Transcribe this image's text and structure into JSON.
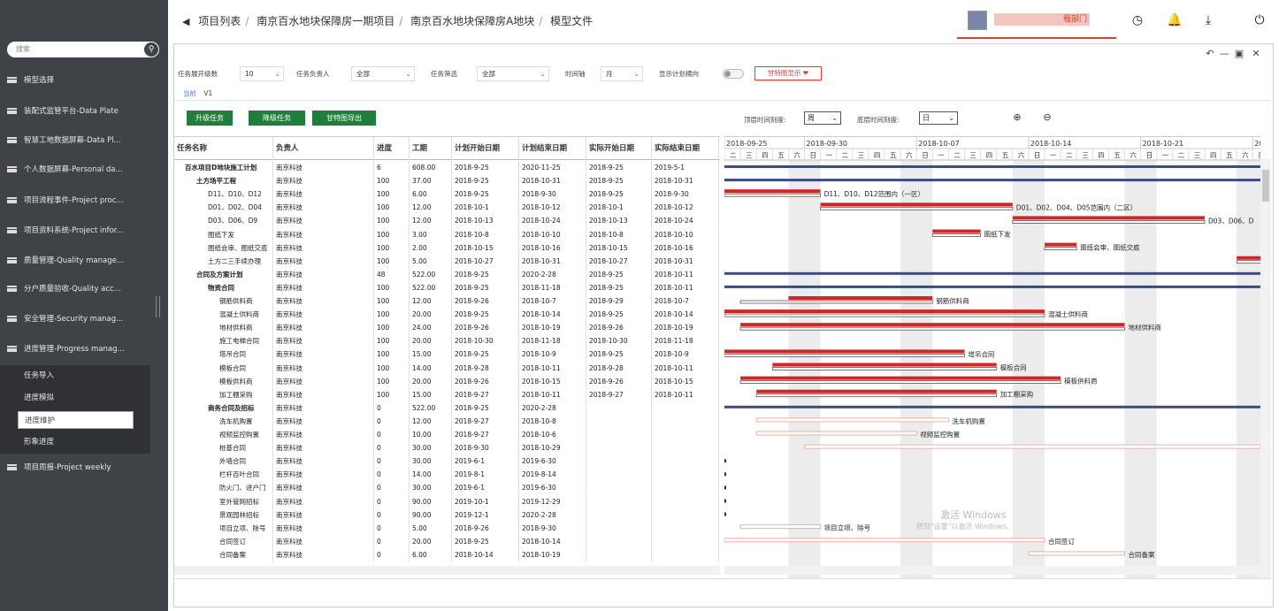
{
  "sidebar": {
    "search_placeholder": "搜索",
    "items": [
      {
        "label": "模型选择"
      },
      {
        "label": "装配式监管平台-Data Plate"
      },
      {
        "label": "智慧工地数据屏幕-Data Pl..."
      },
      {
        "label": "个人数据屏幕-Personal da..."
      },
      {
        "label": "项目流程事件-Project proc..."
      },
      {
        "label": "项目资料系统-Project infor..."
      },
      {
        "label": "质量管理-Quality manage..."
      },
      {
        "label": "分户质量验收-Quality acc..."
      },
      {
        "label": "安全管理-Security manag..."
      },
      {
        "label": "进度管理-Progress manag..."
      },
      {
        "label": "项目周报-Project weekly"
      }
    ],
    "sub_items": [
      {
        "label": "任务导入",
        "active": false
      },
      {
        "label": "进度模拟",
        "active": false
      },
      {
        "label": "进度维护",
        "active": true
      },
      {
        "label": "形象进度",
        "active": false
      }
    ]
  },
  "header": {
    "breadcrumb": [
      "项目列表",
      "南京百水地块保障房一期项目",
      "南京百水地块保障房A地块",
      "模型文件"
    ],
    "user_dept": "程部门",
    "icons": [
      "clock-icon",
      "bell-icon",
      "download-icon",
      "power-icon"
    ]
  },
  "filters": {
    "level_label": "任务展开级数",
    "level_value": "10",
    "owner_label": "任务负责人",
    "owner_value": "全部",
    "filter_label": "任务筛选",
    "filter_value": "全部",
    "axis_label": "时间轴",
    "axis_value": "月",
    "plan_toggle_label": "显示计划横向",
    "red_button": "甘特图显示 ❤"
  },
  "version": {
    "current": "当前",
    "label": "V1"
  },
  "actions": {
    "upgrade": "升级任务",
    "downgrade": "降级任务",
    "export": "甘特图导出"
  },
  "zoom": {
    "top_label": "顶层时间刻度:",
    "top_value": "周",
    "bottom_label": "底层时间刻度:",
    "bottom_value": "日"
  },
  "table": {
    "columns": [
      "任务名称",
      "负责人",
      "进度",
      "工期",
      "计划开始日期",
      "计划结束日期",
      "实际开始日期",
      "实际结束日期"
    ],
    "rows": [
      {
        "name": "百水项目D地块施工计划",
        "owner": "南京科技",
        "progress": "6",
        "duration": "608.00",
        "ps": "2018-9-25",
        "pe": "2020-11-25",
        "as": "2018-9-25",
        "ae": "2019-5-1",
        "level": 0,
        "bold": true
      },
      {
        "name": "土方场平工程",
        "owner": "南京科技",
        "progress": "100",
        "duration": "37.00",
        "ps": "2018-9-25",
        "pe": "2018-10-31",
        "as": "2018-9-25",
        "ae": "2018-10-31",
        "level": 1,
        "bold": true
      },
      {
        "name": "D11、D10、D12",
        "owner": "南京科技",
        "progress": "100",
        "duration": "6.00",
        "ps": "2018-9-25",
        "pe": "2018-9-30",
        "as": "2018-9-25",
        "ae": "2018-9-30",
        "level": 2,
        "bold": false
      },
      {
        "name": "D01、D02、D04",
        "owner": "南京科技",
        "progress": "100",
        "duration": "12.00",
        "ps": "2018-10-1",
        "pe": "2018-10-12",
        "as": "2018-10-1",
        "ae": "2018-10-12",
        "level": 2,
        "bold": false
      },
      {
        "name": "D03、D06、D9",
        "owner": "南京科技",
        "progress": "100",
        "duration": "12.00",
        "ps": "2018-10-13",
        "pe": "2018-10-24",
        "as": "2018-10-13",
        "ae": "2018-10-24",
        "level": 2,
        "bold": false
      },
      {
        "name": "图纸下发",
        "owner": "南京科技",
        "progress": "100",
        "duration": "3.00",
        "ps": "2018-10-8",
        "pe": "2018-10-10",
        "as": "2018-10-8",
        "ae": "2018-10-10",
        "level": 2,
        "bold": false
      },
      {
        "name": "图纸会审、图纸交底",
        "owner": "南京科技",
        "progress": "100",
        "duration": "2.00",
        "ps": "2018-10-15",
        "pe": "2018-10-16",
        "as": "2018-10-15",
        "ae": "2018-10-16",
        "level": 2,
        "bold": false
      },
      {
        "name": "土方二三手续办理",
        "owner": "南京科技",
        "progress": "100",
        "duration": "5.00",
        "ps": "2018-10-27",
        "pe": "2018-10-31",
        "as": "2018-10-27",
        "ae": "2018-10-31",
        "level": 2,
        "bold": false
      },
      {
        "name": "合同及方案计划",
        "owner": "南京科技",
        "progress": "48",
        "duration": "522.00",
        "ps": "2018-9-25",
        "pe": "2020-2-28",
        "as": "2018-9-25",
        "ae": "2018-10-11",
        "level": 1,
        "bold": true
      },
      {
        "name": "物资合同",
        "owner": "南京科技",
        "progress": "100",
        "duration": "522.00",
        "ps": "2018-9-25",
        "pe": "2018-11-18",
        "as": "2018-9-25",
        "ae": "2018-10-11",
        "level": 2,
        "bold": true
      },
      {
        "name": "钢筋供料商",
        "owner": "南京科技",
        "progress": "100",
        "duration": "12.00",
        "ps": "2018-9-26",
        "pe": "2018-10-7",
        "as": "2018-9-29",
        "ae": "2018-10-7",
        "level": 3,
        "bold": false
      },
      {
        "name": "混凝土供料商",
        "owner": "南京科技",
        "progress": "100",
        "duration": "20.00",
        "ps": "2018-9-25",
        "pe": "2018-10-14",
        "as": "2018-9-25",
        "ae": "2018-10-14",
        "level": 3,
        "bold": false
      },
      {
        "name": "地材供料商",
        "owner": "南京科技",
        "progress": "100",
        "duration": "24.00",
        "ps": "2018-9-26",
        "pe": "2018-10-19",
        "as": "2018-9-26",
        "ae": "2018-10-19",
        "level": 3,
        "bold": false
      },
      {
        "name": "施工电梯合同",
        "owner": "南京科技",
        "progress": "100",
        "duration": "20.00",
        "ps": "2018-10-30",
        "pe": "2018-11-18",
        "as": "2018-10-30",
        "ae": "2018-11-18",
        "level": 3,
        "bold": false
      },
      {
        "name": "塔吊合同",
        "owner": "南京科技",
        "progress": "100",
        "duration": "15.00",
        "ps": "2018-9-25",
        "pe": "2018-10-9",
        "as": "2018-9-25",
        "ae": "2018-10-9",
        "level": 3,
        "bold": false
      },
      {
        "name": "模板合同",
        "owner": "南京科技",
        "progress": "100",
        "duration": "14.00",
        "ps": "2018-9-28",
        "pe": "2018-10-11",
        "as": "2018-9-28",
        "ae": "2018-10-11",
        "level": 3,
        "bold": false
      },
      {
        "name": "模板供料商",
        "owner": "南京科技",
        "progress": "100",
        "duration": "20.00",
        "ps": "2018-9-26",
        "pe": "2018-10-15",
        "as": "2018-9-26",
        "ae": "2018-10-15",
        "level": 3,
        "bold": false
      },
      {
        "name": "加工棚采购",
        "owner": "南京科技",
        "progress": "100",
        "duration": "15.00",
        "ps": "2018-9-27",
        "pe": "2018-10-11",
        "as": "2018-9-27",
        "ae": "2018-10-11",
        "level": 3,
        "bold": false
      },
      {
        "name": "商务合同及招标",
        "owner": "南京科技",
        "progress": "0",
        "duration": "522.00",
        "ps": "2018-9-25",
        "pe": "2020-2-28",
        "as": "",
        "ae": "",
        "level": 2,
        "bold": true
      },
      {
        "name": "洗车机购置",
        "owner": "南京科技",
        "progress": "0",
        "duration": "12.00",
        "ps": "2018-9-27",
        "pe": "2018-10-8",
        "as": "",
        "ae": "",
        "level": 3,
        "bold": false
      },
      {
        "name": "视频监控购置",
        "owner": "南京科技",
        "progress": "0",
        "duration": "10.00",
        "ps": "2018-9-27",
        "pe": "2018-10-6",
        "as": "",
        "ae": "",
        "level": 3,
        "bold": false
      },
      {
        "name": "桩基合同",
        "owner": "南京科技",
        "progress": "0",
        "duration": "30.00",
        "ps": "2018-9-30",
        "pe": "2018-10-29",
        "as": "",
        "ae": "",
        "level": 3,
        "bold": false
      },
      {
        "name": "外墙合同",
        "owner": "南京科技",
        "progress": "0",
        "duration": "30.00",
        "ps": "2019-6-1",
        "pe": "2019-6-30",
        "as": "",
        "ae": "",
        "level": 3,
        "bold": false
      },
      {
        "name": "栏杆百叶合同",
        "owner": "南京科技",
        "progress": "0",
        "duration": "14.00",
        "ps": "2019-8-1",
        "pe": "2019-8-14",
        "as": "",
        "ae": "",
        "level": 3,
        "bold": false
      },
      {
        "name": "防火门、进户门",
        "owner": "南京科技",
        "progress": "0",
        "duration": "30.00",
        "ps": "2019-6-1",
        "pe": "2019-6-30",
        "as": "",
        "ae": "",
        "level": 3,
        "bold": false
      },
      {
        "name": "室外管网招标",
        "owner": "南京科技",
        "progress": "0",
        "duration": "90.00",
        "ps": "2019-10-1",
        "pe": "2019-12-29",
        "as": "",
        "ae": "",
        "level": 3,
        "bold": false
      },
      {
        "name": "景观园林招标",
        "owner": "南京科技",
        "progress": "0",
        "duration": "90.00",
        "ps": "2019-12-1",
        "pe": "2020-2-28",
        "as": "",
        "ae": "",
        "level": 3,
        "bold": false
      },
      {
        "name": "项目立项、除号",
        "owner": "南京科技",
        "progress": "0",
        "duration": "5.00",
        "ps": "2018-9-26",
        "pe": "2018-9-30",
        "as": "",
        "ae": "",
        "level": 3,
        "bold": false
      },
      {
        "name": "合同签订",
        "owner": "南京科技",
        "progress": "0",
        "duration": "20.00",
        "ps": "2018-9-25",
        "pe": "2018-10-14",
        "as": "",
        "ae": "",
        "level": 3,
        "bold": false
      },
      {
        "name": "合同备案",
        "owner": "南京科技",
        "progress": "0",
        "duration": "6.00",
        "ps": "2018-10-14",
        "pe": "2018-10-19",
        "as": "",
        "ae": "",
        "level": 3,
        "bold": false
      }
    ]
  },
  "gantt": {
    "weeks": [
      "2018-09-25",
      "2018-09-30",
      "2018-10-07",
      "2018-10-14",
      "2018-10-21",
      "2018"
    ],
    "day_labels": [
      "二",
      "三",
      "四",
      "五",
      "六",
      "日",
      "一",
      "二",
      "三",
      "四",
      "五",
      "六",
      "日",
      "一",
      "二",
      "三",
      "四",
      "五",
      "六",
      "日",
      "一",
      "二",
      "三",
      "四",
      "五",
      "六",
      "日",
      "一",
      "二",
      "三",
      "四",
      "五",
      "六",
      "日",
      "一"
    ],
    "start_date": "2018-09-25",
    "bar_labels": {
      "2": "D11、D10、D12范围内（一区）",
      "3": "D01、D02、D04、D05范围内（二区）",
      "4": "D03、D06、D",
      "5": "图纸下发",
      "6": "图纸会审、图纸交底",
      "10": "钢筋供料商",
      "11": "混凝土供料商",
      "12": "地材供料商",
      "14": "塔吊合同",
      "15": "模板合同",
      "16": "模板供料商",
      "17": "加工棚采购",
      "19": "洗车机购置",
      "20": "视频监控购置",
      "27": "项目立项、除号",
      "28": "合同签订",
      "29": "合同备案"
    },
    "colors": {
      "summary": "#3b4a8a",
      "actual": "#e02020",
      "plan_border": "#555",
      "pending": "#e8a090",
      "weekend": "#ececec"
    }
  },
  "watermark": {
    "line1": "激活 Windows",
    "line2": "转到\"设置\"以激活 Windows。"
  }
}
